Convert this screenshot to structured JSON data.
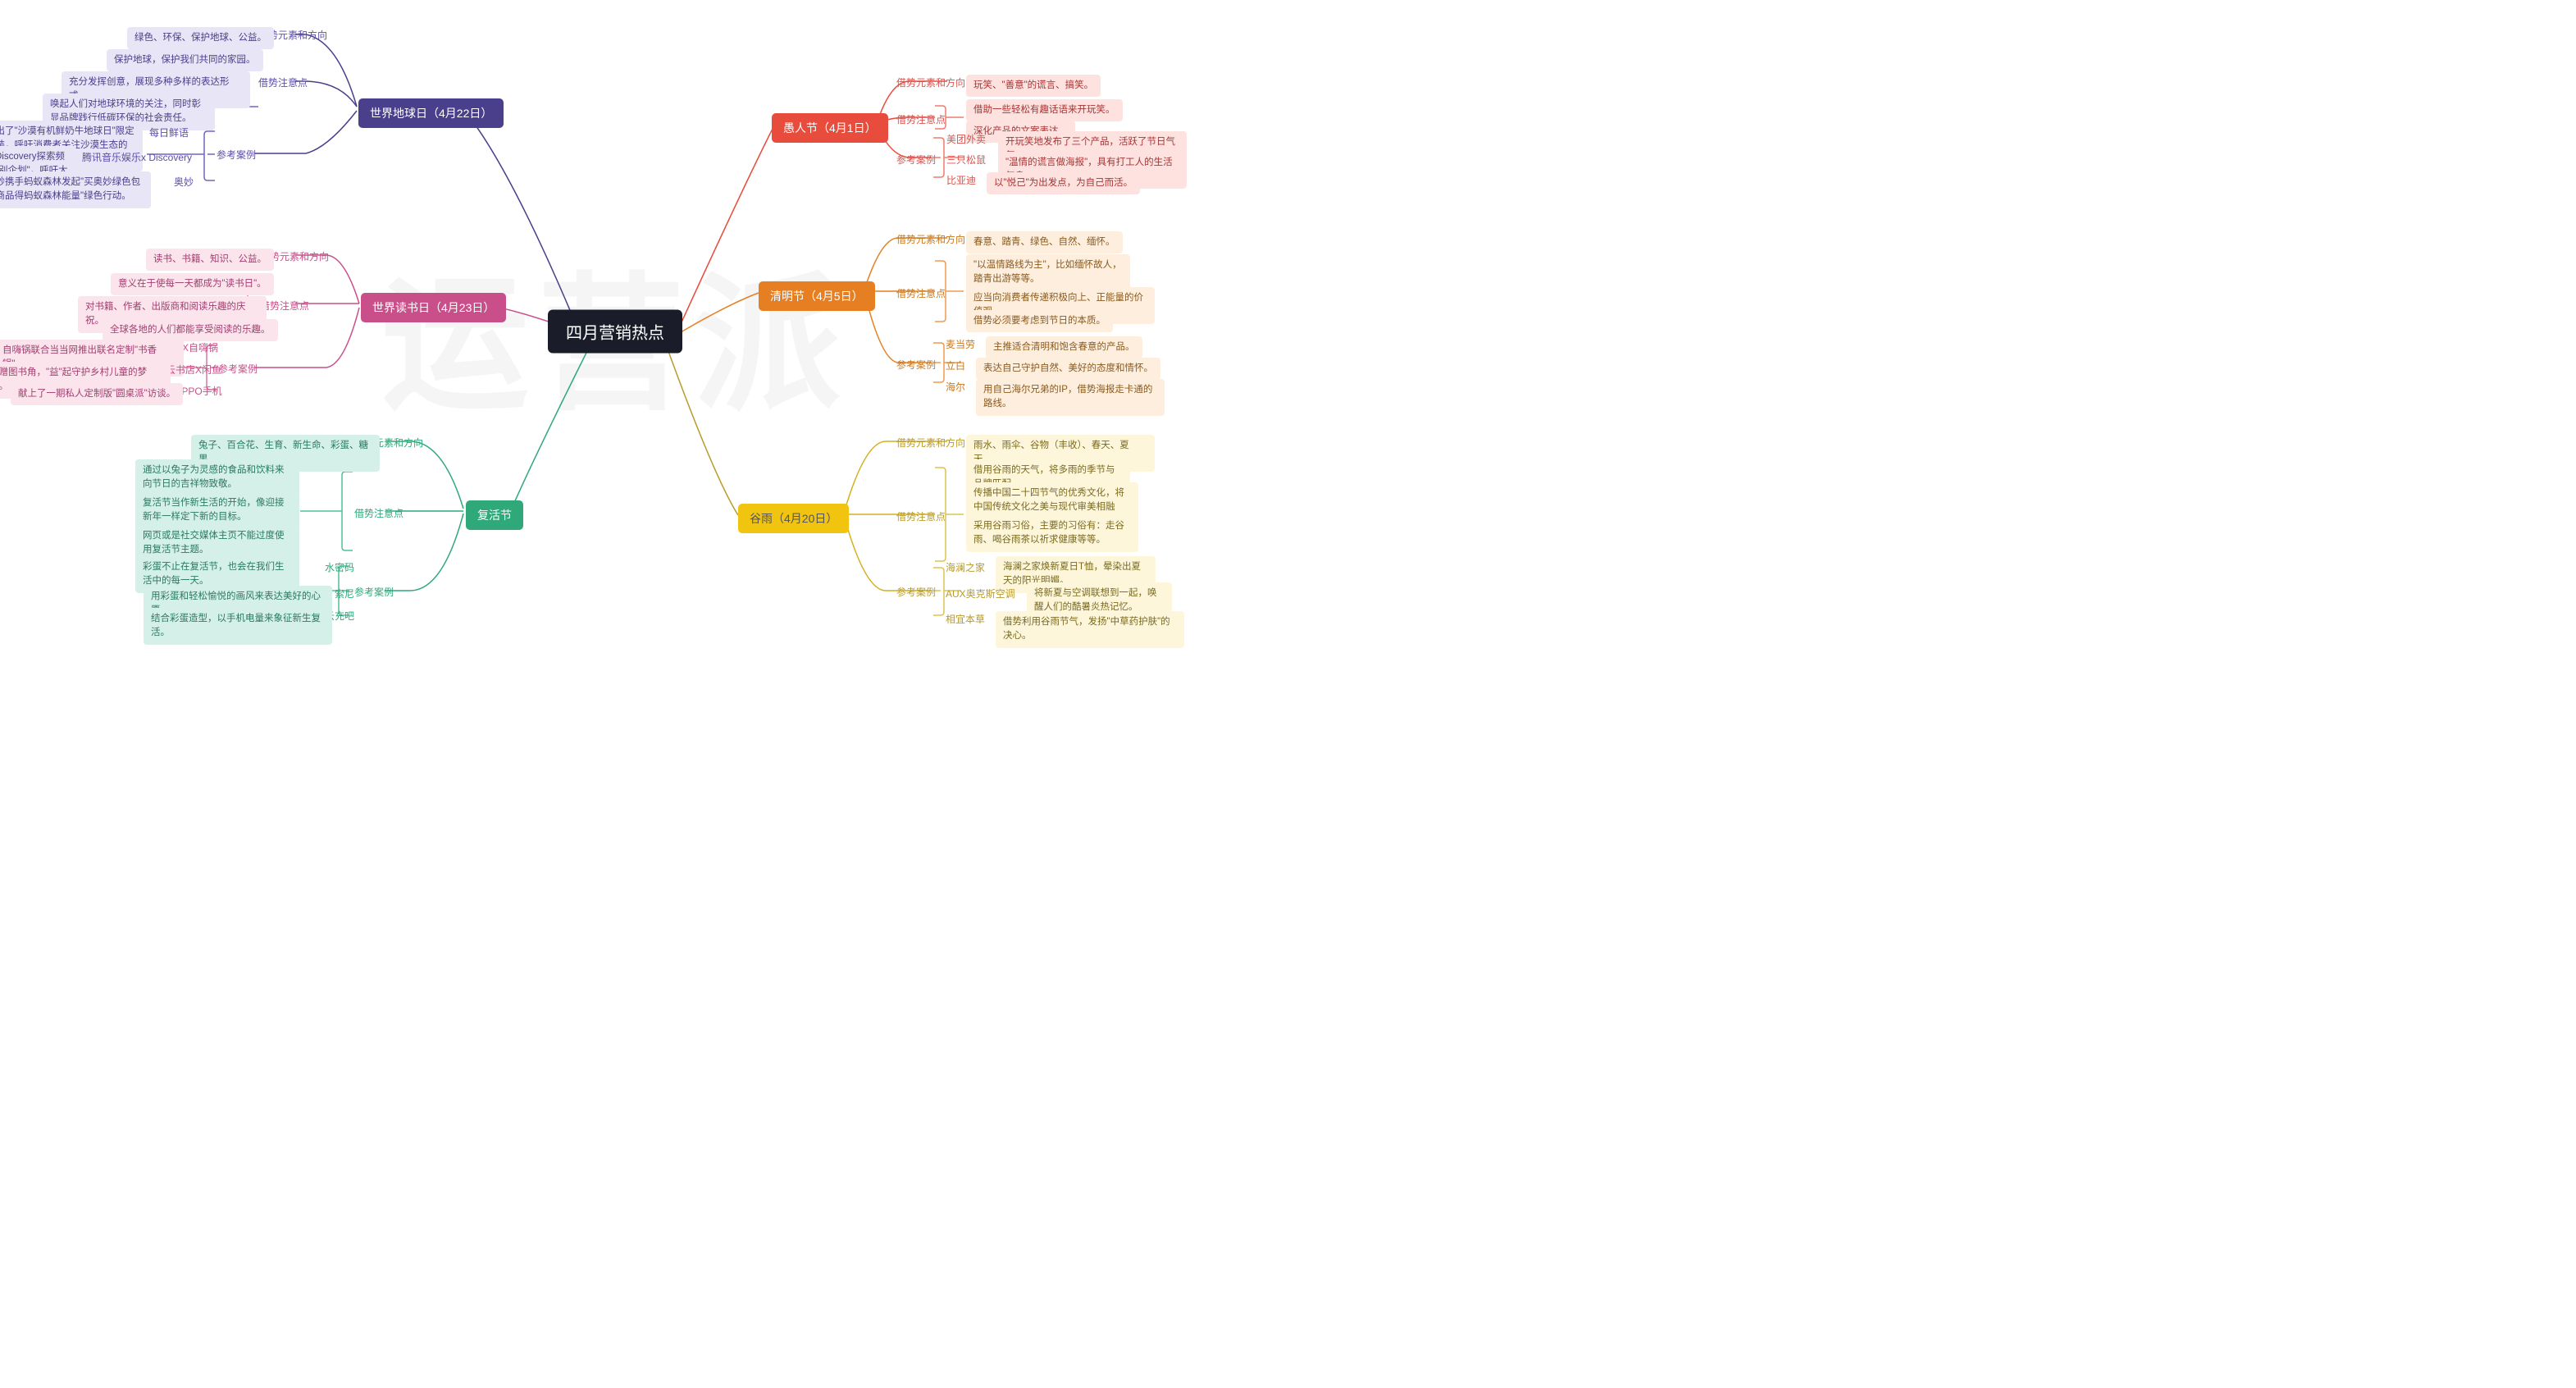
{
  "center": "四月营销热点",
  "watermark": "运营派",
  "branches": {
    "earth": {
      "label": "世界地球日（4月22日）",
      "elements_label": "借势元素和方向",
      "elements": "绿色、环保、保护地球、公益。",
      "tips_label": "借势注意点",
      "tips": [
        "保护地球，保护我们共同的家园。",
        "充分发挥创意，展现多种多样的表达形式。",
        "唤起人们对地球环境的关注，同时彰显品牌践行低碳环保的社会责任。"
      ],
      "cases_label": "参考案例",
      "cases": [
        {
          "name": "每日鲜语",
          "desc": "推出了\"沙漠有机鲜奶牛地球日\"限定包装，呼吁消费者关注沙漠生态的可持续发展。"
        },
        {
          "name": "腾讯音乐娱乐x Discovery",
          "desc": "腾讯音乐娱乐联合Discovery探索频道发起\"音乐公益特别企划\"，呼吁大众关注生物的多样性。"
        },
        {
          "name": "奥妙",
          "desc": "奥妙携手蚂蚁森林发起\"买奥妙绿色包装商品得蚂蚁森林能量\"绿色行动。"
        }
      ]
    },
    "book": {
      "label": "世界读书日（4月23日）",
      "elements_label": "借势元素和方向",
      "elements": "读书、书籍、知识、公益。",
      "tips_label": "借势注意点",
      "tips": [
        "意义在于使每一天都成为\"读书日\"。",
        "对书籍、作者、出版商和阅读乐趣的庆祝。",
        "全球各地的人们都能享受阅读的乐趣。"
      ],
      "cases_label": "参考案例",
      "cases": [
        {
          "name": "当当X自嗨锅",
          "desc": "自嗨锅联合当当网推出联名定制\"书香锅\"。"
        },
        {
          "name": "咪咕云书店X闲鱼",
          "desc": "捐赠图书角，\"益\"起守护乡村儿童的梦想。"
        },
        {
          "name": "OPPO手机",
          "desc": "献上了一期私人定制版\"圆桌派\"访谈。"
        }
      ]
    },
    "easter": {
      "label": "复活节",
      "elements_label": "借势元素和方向",
      "elements": "兔子、百合花、生育、新生命、彩蛋、糖果。",
      "tips_label": "借势注意点",
      "tips": [
        "通过以兔子为灵感的食品和饮料来向节日的吉祥物致敬。",
        "复活节当作新生活的开始，像迎接新年一样定下新的目标。",
        "网页或是社交媒体主页不能过度使用复活节主题。"
      ],
      "cases_label": "参考案例",
      "cases": [
        {
          "name": "水密码",
          "desc": "彩蛋不止在复活节，也会在我们生活中的每一天。"
        },
        {
          "name": "索尼",
          "desc": "用彩蛋和轻松愉悦的画风来表达美好的心愿。"
        },
        {
          "name": "云充吧",
          "desc": "结合彩蛋造型，以手机电量来象征新生复活。"
        }
      ]
    },
    "fools": {
      "label": "愚人节（4月1日）",
      "elements_label": "借势元素和方向",
      "elements": "玩笑、\"善意\"的谎言、搞笑。",
      "tips_label": "借势注意点",
      "tips": [
        "借助一些轻松有趣话语来开玩笑。",
        "深化产品的文案表达。"
      ],
      "cases_label": "参考案例",
      "cases": [
        {
          "name": "美团外卖",
          "desc": "开玩笑地发布了三个产品，活跃了节日气氛。"
        },
        {
          "name": "三只松鼠",
          "desc": "\"温情的谎言做海报\"，具有打工人的生活气息。"
        },
        {
          "name": "比亚迪",
          "desc": "以\"悦己\"为出发点，为自己而活。"
        }
      ]
    },
    "qingming": {
      "label": "清明节（4月5日）",
      "elements_label": "借势元素和方向",
      "elements": "春意、踏青、绿色、自然、缅怀。",
      "tips_label": "借势注意点",
      "tips": [
        "\"以温情路线为主\"，比如缅怀故人，踏青出游等等。",
        "应当向消费者传递积极向上、正能量的价值观。",
        "借势必须要考虑到节日的本质。"
      ],
      "cases_label": "参考案例",
      "cases": [
        {
          "name": "麦当劳",
          "desc": "主推适合清明和饱含春意的产品。"
        },
        {
          "name": "立白",
          "desc": "表达自己守护自然、美好的态度和情怀。"
        },
        {
          "name": "海尔",
          "desc": "用自己海尔兄弟的IP，借势海报走卡通的路线。"
        }
      ]
    },
    "guyu": {
      "label": "谷雨（4月20日）",
      "elements_label": "借势元素和方向",
      "elements": "雨水、雨伞、谷物（丰收）、春天、夏天。",
      "tips_label": "借势注意点",
      "tips": [
        "借用谷雨的天气，将多雨的季节与品牌匹配。",
        "传播中国二十四节气的优秀文化，将中国传统文化之美与现代审美相融合。",
        "采用谷雨习俗，主要的习俗有：走谷雨、喝谷雨茶以祈求健康等等。"
      ],
      "cases_label": "参考案例",
      "cases": [
        {
          "name": "海澜之家",
          "desc": "海澜之家焕新夏日T恤，晕染出夏天的阳光明媚。"
        },
        {
          "name": "AUX奥克斯空调",
          "desc": "将新夏与空调联想到一起，唤醒人们的酷暑炎热记忆。"
        },
        {
          "name": "相宜本草",
          "desc": "借势利用谷雨节气，发扬\"中草药护肤\"的决心。"
        }
      ]
    }
  }
}
